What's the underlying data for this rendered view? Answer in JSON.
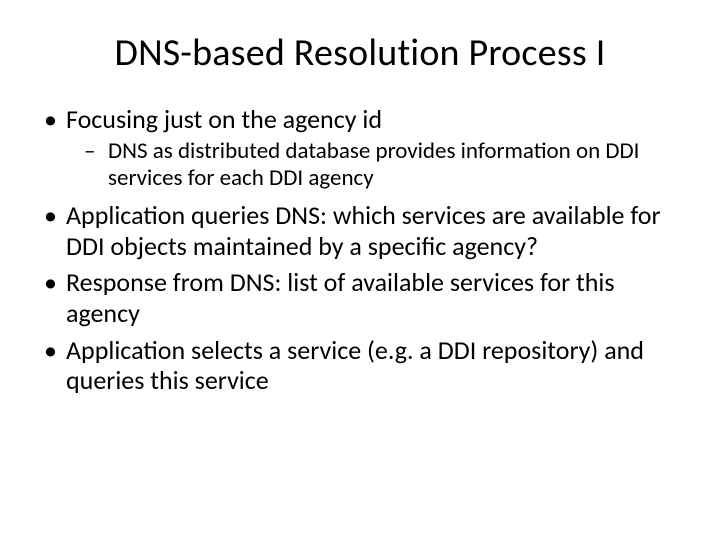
{
  "title": "DNS-based Resolution Process I",
  "bullets": {
    "b0": "Focusing just on the agency id",
    "b0_sub0": "DNS as distributed database provides information on DDI services for each DDI agency",
    "b1": "Application queries DNS: which services are available for DDI objects maintained by a specific agency?",
    "b2": "Response from DNS: list of available services for this agency",
    "b3": "Application selects a service (e.g. a DDI repository) and queries this service"
  }
}
